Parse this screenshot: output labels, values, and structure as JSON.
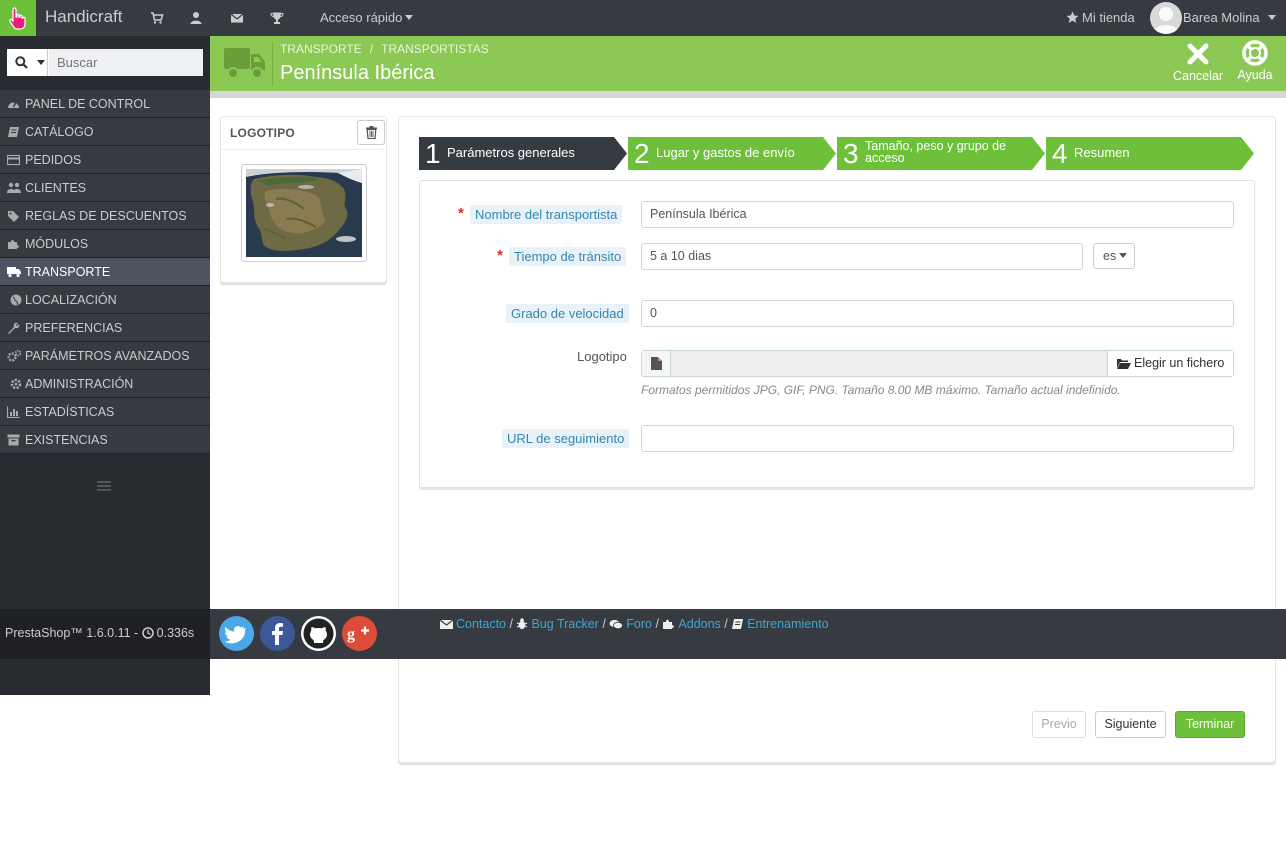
{
  "topbar": {
    "shop_name": "Handicraft",
    "quick_access": "Acceso rápido",
    "my_store": "Mi tienda",
    "user_name": "Barea Molina"
  },
  "sidebar": {
    "search_placeholder": "Buscar",
    "items": [
      {
        "label": "PANEL DE CONTROL",
        "icon": "dashboard-icon"
      },
      {
        "label": "CATÁLOGO",
        "icon": "book-icon"
      },
      {
        "label": "PEDIDOS",
        "icon": "credit-card-icon"
      },
      {
        "label": "CLIENTES",
        "icon": "users-icon"
      },
      {
        "label": "REGLAS DE DESCUENTOS",
        "icon": "tags-icon"
      },
      {
        "label": "MÓDULOS",
        "icon": "puzzle-icon"
      },
      {
        "label": "TRANSPORTE",
        "icon": "truck-icon",
        "active": true
      },
      {
        "label": "LOCALIZACIÓN",
        "icon": "globe-icon"
      },
      {
        "label": "PREFERENCIAS",
        "icon": "wrench-icon"
      },
      {
        "label": "PARÁMETROS AVANZADOS",
        "icon": "cogs-icon"
      },
      {
        "label": "ADMINISTRACIÓN",
        "icon": "cog-icon"
      },
      {
        "label": "ESTADÍSTICAS",
        "icon": "bar-chart-icon"
      },
      {
        "label": "EXISTENCIAS",
        "icon": "archive-icon"
      }
    ]
  },
  "header": {
    "breadcrumb": [
      "TRANSPORTE",
      "TRANSPORTISTAS"
    ],
    "title": "Península Ibérica",
    "cancel_label": "Cancelar",
    "help_label": "Ayuda"
  },
  "logo_panel": {
    "title": "LOGOTIPO"
  },
  "wizard": {
    "steps": [
      {
        "num": "1",
        "label": "Parámetros generales",
        "state": "current"
      },
      {
        "num": "2",
        "label": "Lugar y gastos de envío",
        "state": "pending"
      },
      {
        "num": "3",
        "label": "Tamaño, peso y grupo de acceso",
        "state": "pending"
      },
      {
        "num": "4",
        "label": "Resumen",
        "state": "pending"
      }
    ],
    "fields": {
      "carrier_name_label": "Nombre del transportista",
      "carrier_name_value": "Península Ibérica",
      "transit_time_label": "Tiempo de tránsito",
      "transit_time_value": "5 a 10 dias",
      "language": "es",
      "speed_grade_label": "Grado de velocidad",
      "speed_grade_value": "0",
      "logo_label": "Logotipo",
      "choose_file_label": "Elegir un fichero",
      "logo_help": "Formatos permitidos JPG, GIF, PNG. Tamaño 8.00 MB máximo. Tamaño actual indefinido.",
      "tracking_url_label": "URL de seguimiento",
      "tracking_url_value": ""
    },
    "buttons": {
      "prev": "Previo",
      "next": "Siguiente",
      "finish": "Terminar"
    }
  },
  "footer": {
    "version": "PrestaShop™ 1.6.0.11 - ",
    "load_time": "0.336s",
    "links": [
      "Contacto",
      "Bug Tracker",
      "Foro",
      "Addons",
      "Entrenamiento"
    ]
  },
  "colors": {
    "accent_green": "#8bc954",
    "step_current": "#363a41",
    "step_pending": "#6ec03b",
    "sidebar_bg": "#363a41"
  }
}
